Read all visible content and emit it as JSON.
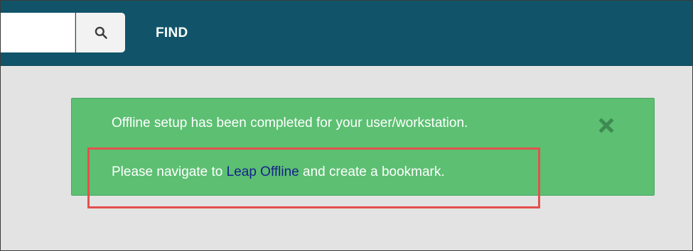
{
  "header": {
    "search": {
      "value": "",
      "placeholder": ""
    },
    "search_icon": "search-icon",
    "find_label": "FIND"
  },
  "alert": {
    "line1": "Offline setup has been completed for your user/workstation.",
    "line2_before": "Please navigate to ",
    "line2_link": "Leap Offline",
    "line2_after": " and create a bookmark.",
    "close_icon": "close-icon"
  },
  "colors": {
    "header_background": "#11546a",
    "page_background": "#e3e3e3",
    "alert_background": "#5cbf72",
    "alert_text": "#ffffff",
    "link_text": "#17228a",
    "close_icon": "#3f8a52",
    "highlight_border": "#e4504e"
  }
}
